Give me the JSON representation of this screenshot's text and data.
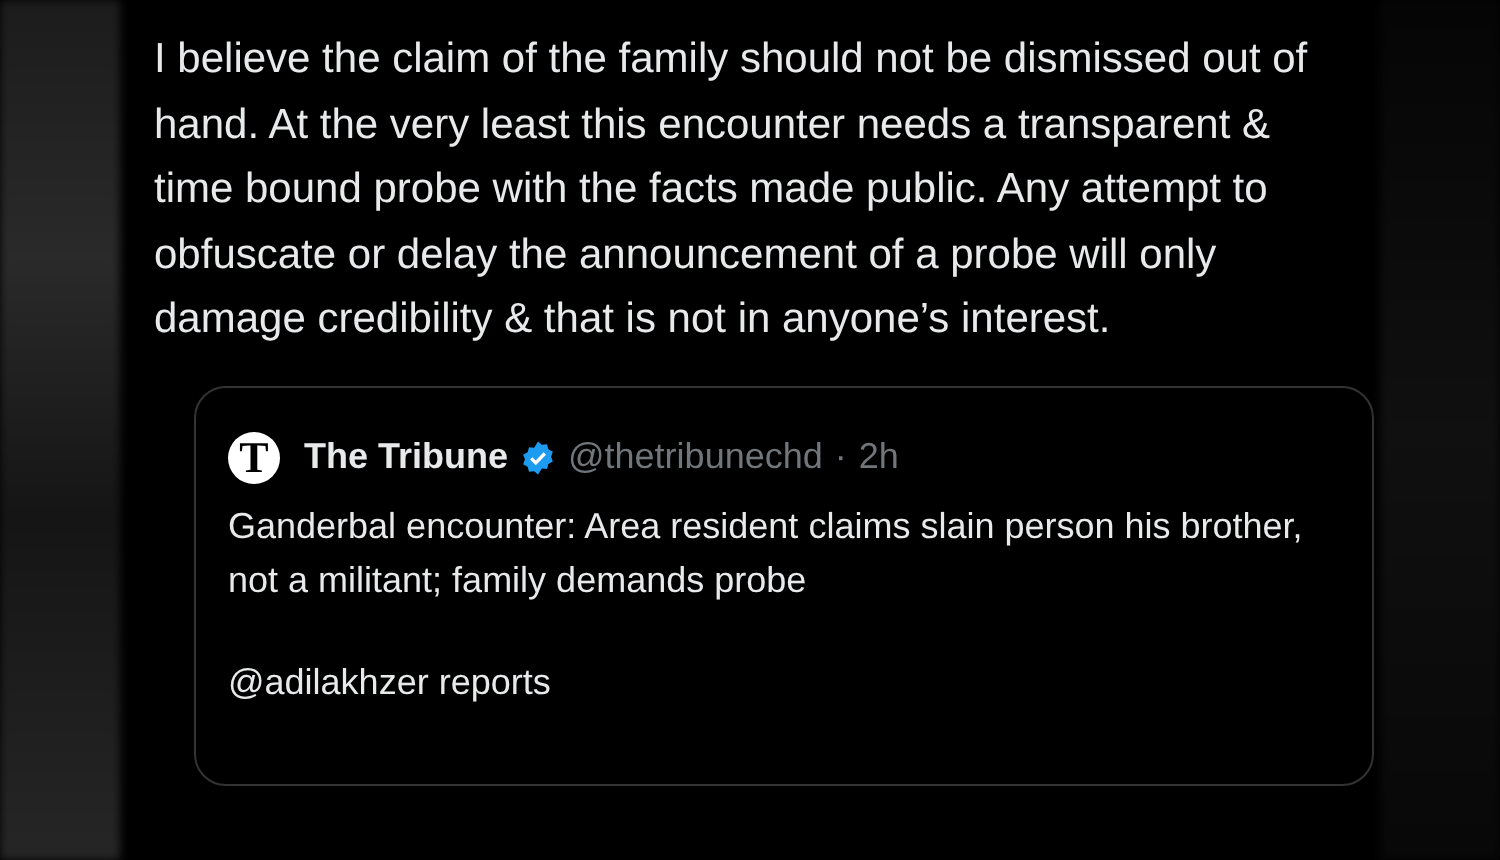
{
  "tweet": {
    "text": "I believe the claim of the family should not be dismissed out of hand. At the very least this encounter needs a transparent & time bound probe with the facts made public. Any attempt to obfuscate or delay the announcement of a probe will only damage credibility & that is not in anyone’s interest.",
    "quote": {
      "name": "The Tribune",
      "verified": true,
      "handle": "@thetribunechd",
      "separator": "·",
      "time": "2h",
      "logo_letter": "T",
      "text": "Ganderbal encounter: Area resident claims slain person his brother, not a militant; family demands probe",
      "link": "@adilakhzer reports"
    }
  }
}
